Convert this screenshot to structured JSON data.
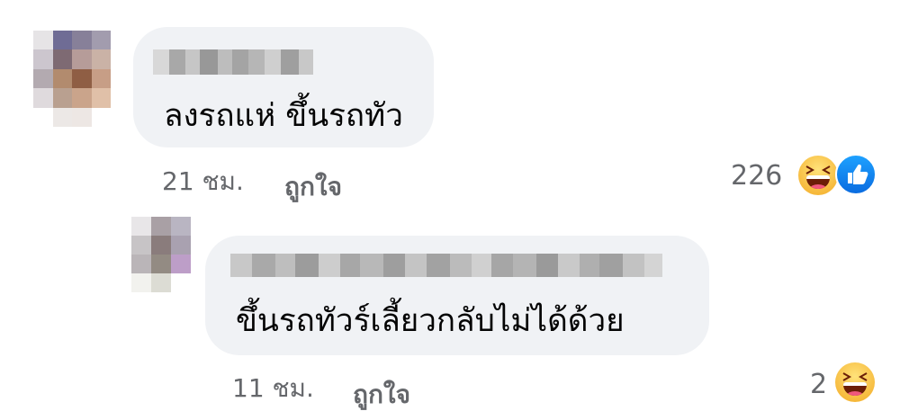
{
  "colors": {
    "bubble": "#f0f2f5",
    "meta_text": "#65676b",
    "comment_text": "#050505",
    "like_blue": "#1877f2",
    "haha_yellow": "#f7b928"
  },
  "comments": [
    {
      "text": "ลงรถแห่ ขึ้นรถทัว",
      "time": "21 ชม.",
      "like_label": "ถูกใจ",
      "reaction_count": "226",
      "reactions": [
        "haha-icon",
        "like-icon"
      ]
    },
    {
      "text": "ขึ้นรถทัวร์เลี้ยวกลับไม่ได้ด้วย",
      "time": "11 ชม.",
      "like_label": "ถูกใจ",
      "reaction_count": "2",
      "reactions": [
        "haha-icon"
      ]
    }
  ]
}
